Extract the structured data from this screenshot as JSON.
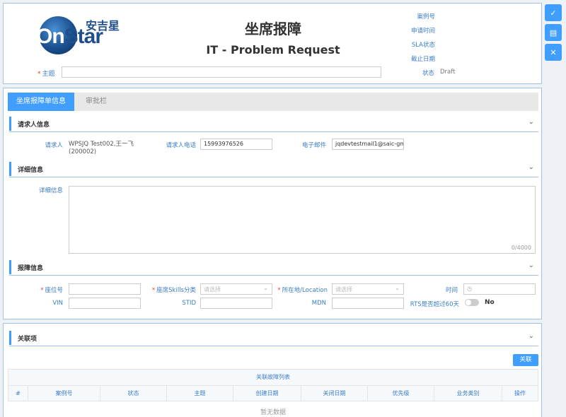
{
  "header": {
    "logo_text_on": "On",
    "logo_text_star": "Star",
    "logo_text_cn": "安吉星",
    "title_cn": "坐席报障",
    "title_en": "IT - Problem Request",
    "meta": [
      "案例号",
      "申请时间",
      "SLA状态",
      "截止日期"
    ],
    "subject_label": "主题",
    "subject_value": "",
    "status_label": "状态",
    "status_value": "Draft"
  },
  "toolbar": {
    "icons": [
      "check-icon",
      "document-icon",
      "close-icon"
    ],
    "glyphs": [
      "✓",
      "▤",
      "✕"
    ]
  },
  "tabs": [
    {
      "label": "坐席报障单信息",
      "active": true
    },
    {
      "label": "审批栏",
      "active": false
    }
  ],
  "requester": {
    "section_title": "请求人信息",
    "name_label": "请求人",
    "name_value": "WPSJQ Test002,王一飞 (200002)",
    "phone_label": "请求人电话",
    "phone_value": "15993976526",
    "email_label": "电子邮件",
    "email_value": "jqdevtestmail1@saic-gm."
  },
  "detail": {
    "section_title": "详细信息",
    "label": "详细信息",
    "value": "",
    "counter": "0/4000"
  },
  "fault": {
    "section_title": "报障信息",
    "seat_label": "座位号",
    "skills_label": "座席Skills分类",
    "skills_placeholder": "请选择",
    "location_label": "所在地/Location",
    "location_placeholder": "请选择",
    "time_label": "时间",
    "time_icon": "◷",
    "vin_label": "VIN",
    "stid_label": "STID",
    "mdn_label": "MDN",
    "rts_label": "RTS是否超过60天",
    "rts_value": "No"
  },
  "related": {
    "section_title": "关联项",
    "button_label": "关联",
    "table_caption": "关联故障列表",
    "columns": [
      "#",
      "案例号",
      "状态",
      "主题",
      "创建日期",
      "关闭日期",
      "优先级",
      "业务类别",
      "操作"
    ],
    "empty_text": "暂无数据"
  },
  "colors": {
    "accent": "#409eff",
    "label": "#3a7cc7",
    "required": "#e23c3c"
  }
}
